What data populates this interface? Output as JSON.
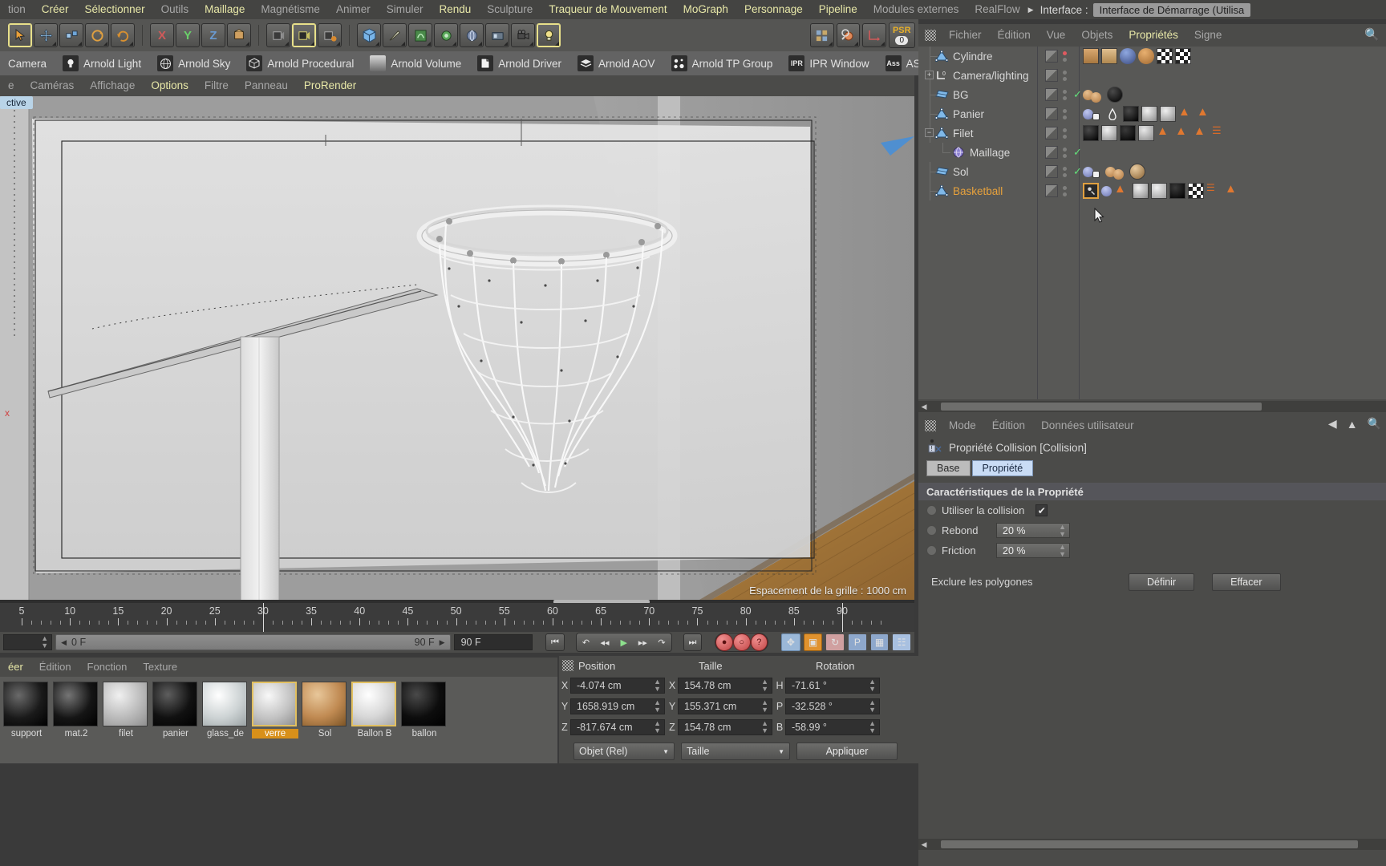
{
  "menubar": {
    "items": [
      {
        "label": "tion",
        "hl": false
      },
      {
        "label": "Créer",
        "hl": true
      },
      {
        "label": "Sélectionner",
        "hl": true
      },
      {
        "label": "Outils",
        "hl": false
      },
      {
        "label": "Maillage",
        "hl": true
      },
      {
        "label": "Magnétisme",
        "hl": false
      },
      {
        "label": "Animer",
        "hl": false
      },
      {
        "label": "Simuler",
        "hl": false
      },
      {
        "label": "Rendu",
        "hl": true
      },
      {
        "label": "Sculpture",
        "hl": false
      },
      {
        "label": "Traqueur de Mouvement",
        "hl": true
      },
      {
        "label": "MoGraph",
        "hl": true
      },
      {
        "label": "Personnage",
        "hl": true
      },
      {
        "label": "Pipeline",
        "hl": true
      },
      {
        "label": "Modules externes",
        "hl": false
      },
      {
        "label": "RealFlow",
        "hl": false
      }
    ],
    "interface_label": "Interface :",
    "interface_value": "Interface de Démarrage (Utilisa"
  },
  "toolbar": {
    "psr_label": "PSR",
    "psr_value": "0",
    "axes": [
      "X",
      "Y",
      "Z"
    ]
  },
  "arnold_shelf": {
    "items": [
      {
        "label": "Camera",
        "icon": "camera-icon"
      },
      {
        "label": "Arnold Light",
        "icon": "light-bulb-icon"
      },
      {
        "label": "Arnold Sky",
        "icon": "sky-globe-icon"
      },
      {
        "label": "Arnold Procedural",
        "icon": "procedural-cube-icon"
      },
      {
        "label": "Arnold Volume",
        "icon": "volume-icon"
      },
      {
        "label": "Arnold Driver",
        "icon": "driver-page-icon"
      },
      {
        "label": "Arnold AOV",
        "icon": "aov-layers-icon"
      },
      {
        "label": "Arnold TP Group",
        "icon": "tp-group-dots-icon"
      },
      {
        "label": "IPR Window",
        "icon": "ipr-icon"
      },
      {
        "label": "ASS Ex",
        "icon": "ass-icon"
      }
    ],
    "ipr_badge": "IPR",
    "ass_badge": "Ass"
  },
  "viewport_menu": {
    "items": [
      "e",
      "Caméras",
      "Affichage",
      "Options",
      "Filtre",
      "Panneau",
      "ProRender"
    ],
    "highlighted": [
      "Options",
      "ProRender"
    ]
  },
  "viewport": {
    "perspective_tag": "ctive",
    "grid_spacing": "Espacement de la grille : 1000 cm",
    "axis_x_label": "x"
  },
  "timeline": {
    "ticks": [
      5,
      10,
      15,
      20,
      25,
      30,
      35,
      40,
      45,
      50,
      55,
      60,
      65,
      70,
      75,
      80,
      85,
      90
    ],
    "current_frame_field": "0 F",
    "start_field": "0 F",
    "end_field": "90 F",
    "range_end": "90 F"
  },
  "material_manager": {
    "menu": [
      "éer",
      "Édition",
      "Fonction",
      "Texture"
    ],
    "materials": [
      {
        "name": "support",
        "color": "#171717",
        "selected": false
      },
      {
        "name": "mat.2",
        "color": "#1a1a1a",
        "selected": false
      },
      {
        "name": "filet",
        "color": "#b9b9b9",
        "selected": false
      },
      {
        "name": "panier",
        "color": "#131313",
        "selected": false
      },
      {
        "name": "glass_de",
        "color": "#c3c7c8",
        "selected": false
      },
      {
        "name": "verre",
        "color": "#b5b5b5",
        "selected": true
      },
      {
        "name": "Sol",
        "color": "#c08a52",
        "selected": false
      },
      {
        "name": "Ballon B",
        "color": "#d7d7d7",
        "selected": false
      },
      {
        "name": "ballon",
        "color": "#101010",
        "selected": false
      }
    ]
  },
  "coordinate_manager": {
    "headers": [
      "Position",
      "Taille",
      "Rotation"
    ],
    "rows": [
      {
        "axis": "X",
        "position": "-4.074 cm",
        "axis2": "X",
        "size": "154.78 cm",
        "axis3": "H",
        "rotation": "-71.61 °"
      },
      {
        "axis": "Y",
        "position": "1658.919 cm",
        "axis2": "Y",
        "size": "155.371 cm",
        "axis3": "P",
        "rotation": "-32.528 °"
      },
      {
        "axis": "Z",
        "position": "-817.674 cm",
        "axis2": "Z",
        "size": "154.78 cm",
        "axis3": "B",
        "rotation": "-58.99 °"
      }
    ],
    "mode_select": "Objet (Rel)",
    "size_select": "Taille",
    "apply_button": "Appliquer"
  },
  "object_manager": {
    "menu": [
      "Fichier",
      "Édition",
      "Vue",
      "Objets",
      "Propriétés",
      "Signe"
    ],
    "highlighted": "Propriétés",
    "rows": [
      {
        "name": "Cylindre",
        "icon": "null-object-icon",
        "indent": 1,
        "expander": null,
        "check": false,
        "dot_red": true,
        "tags": [
          "clapper-tag",
          "eye-tag",
          "person-tag",
          "sphere-tag",
          "checker-tag",
          "checker-tag"
        ]
      },
      {
        "name": "Camera/lighting",
        "icon": "layer-zero-icon",
        "indent": 1,
        "expander": "+",
        "check": false,
        "dot_red": false,
        "tags": []
      },
      {
        "name": "BG",
        "icon": "plane-object-icon",
        "indent": 1,
        "expander": null,
        "check": true,
        "dot_red": false,
        "tags": [
          "material-tan-tag",
          "black-sphere-tag"
        ]
      },
      {
        "name": "Panier",
        "icon": "null-object-icon",
        "indent": 1,
        "expander": null,
        "check": false,
        "dot_red": false,
        "tags": [
          "blue-sphere-tag",
          "dice-tag",
          "collision-tag",
          "black-sphere-tag",
          "grey-sphere-tag",
          "grey-sphere-tag",
          "orange-tag",
          "orange-tag"
        ]
      },
      {
        "name": "Filet",
        "icon": "null-object-icon",
        "indent": 1,
        "expander": "−",
        "check": false,
        "dot_red": false,
        "tags": [
          "black-sphere-tag",
          "grey-sphere-tag",
          "black-sphere-tag",
          "grey-sphere-tag",
          "orange-tag",
          "orange-tag",
          "orange-tag",
          "cloth-tag"
        ]
      },
      {
        "name": "Maillage",
        "icon": "mesh-deformer-icon",
        "indent": 2,
        "expander": null,
        "check": true,
        "dot_red": false,
        "tags": []
      },
      {
        "name": "Sol",
        "icon": "plane-object-icon",
        "indent": 1,
        "expander": null,
        "check": true,
        "dot_red": false,
        "tags": [
          "blue-sphere-tag",
          "dice-tag",
          "material-tan-tag",
          "wood-sphere-tag"
        ]
      },
      {
        "name": "Basketball",
        "icon": "null-object-icon",
        "indent": 1,
        "expander": null,
        "check": false,
        "dot_red": false,
        "selected": true,
        "tags": [
          "collision-sel-tag",
          "blue-sphere-tag",
          "orange-tag",
          "orange-tag",
          "grey-sphere-tag",
          "black-sphere-tag",
          "checker-tag",
          "dyn-tag",
          "orange-tag"
        ]
      }
    ]
  },
  "attribute_manager": {
    "menu": [
      "Mode",
      "Édition",
      "Données utilisateur"
    ],
    "title": "Propriété Collision [Collision]",
    "tabs": [
      {
        "label": "Base",
        "active": false
      },
      {
        "label": "Propriété",
        "active": true
      }
    ],
    "section": "Caractéristiques de la Propriété",
    "fields": [
      {
        "label": "Utiliser la collision",
        "type": "checkbox",
        "value": "✔"
      },
      {
        "label": "Rebond",
        "type": "number",
        "value": "20 %"
      },
      {
        "label": "Friction",
        "type": "number",
        "value": "20 %"
      }
    ],
    "exclude_label": "Exclure les polygones",
    "define_button": "Définir",
    "clear_button": "Effacer"
  },
  "colors": {
    "accent_yellow": "#e8e8a8",
    "selected_orange": "#e8a23c",
    "tab_blue": "#c9dcf5",
    "check_green": "#62e07a"
  }
}
